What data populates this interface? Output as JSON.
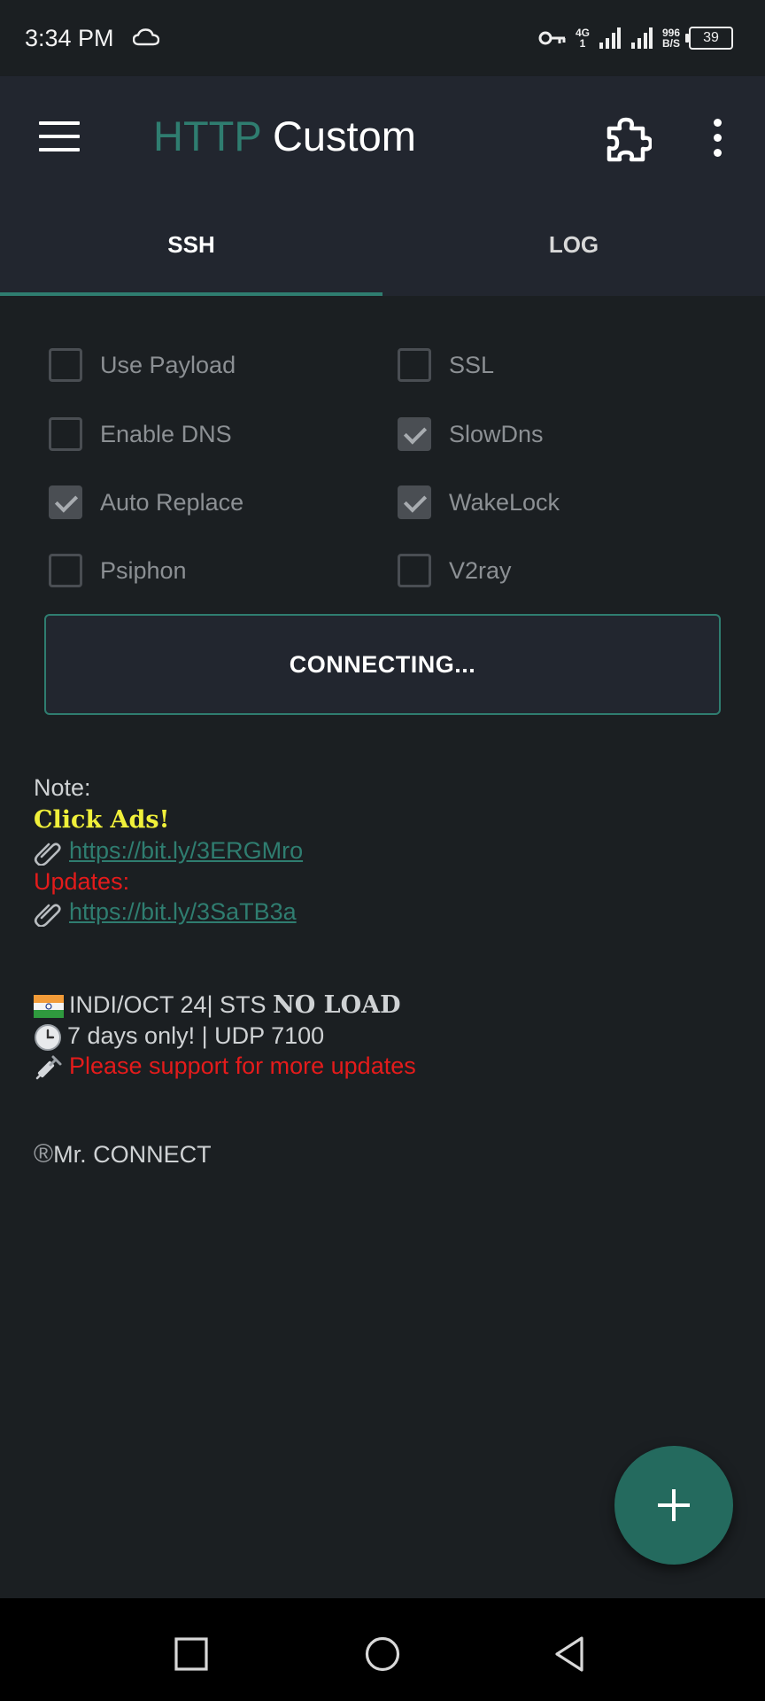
{
  "status_bar": {
    "time": "3:34 PM",
    "network_type": "4G",
    "network_sub": "1",
    "net_speed_value": "996",
    "net_speed_unit": "B/S",
    "battery": "39"
  },
  "app_bar": {
    "title_part1": "HTTP",
    "title_part2": "Custom",
    "accent_color": "#2f7d70"
  },
  "tabs": [
    {
      "label": "SSH",
      "active": true
    },
    {
      "label": "LOG",
      "active": false
    }
  ],
  "options": [
    {
      "label": "Use Payload",
      "checked": false
    },
    {
      "label": "SSL",
      "checked": false
    },
    {
      "label": "Enable DNS",
      "checked": false
    },
    {
      "label": "SlowDns",
      "checked": true
    },
    {
      "label": "Auto Replace",
      "checked": true
    },
    {
      "label": "WakeLock",
      "checked": true
    },
    {
      "label": "Psiphon",
      "checked": false
    },
    {
      "label": "V2ray",
      "checked": false
    }
  ],
  "connect_button": {
    "label": "CONNECTING..."
  },
  "note": {
    "heading": "Note:",
    "click_ads": "Click Ads",
    "click_ads_suffix": "!",
    "link1": "https://bit.ly/3ERGMro",
    "updates": "Updates:",
    "link2": "https://bit.ly/3SaTB3a",
    "line_indi": "INDI/OCT 24| STS ",
    "line_indi_bold": "NO LOAD",
    "line_days": "7 days only! | UDP 7100",
    "line_support": "Please support for more updates",
    "signature_symbol": "®",
    "signature": "Mr. CONNECT"
  },
  "fab": {
    "icon": "plus-icon"
  },
  "nav_bar": {
    "icons": [
      "square-icon",
      "circle-icon",
      "triangle-back-icon"
    ]
  }
}
